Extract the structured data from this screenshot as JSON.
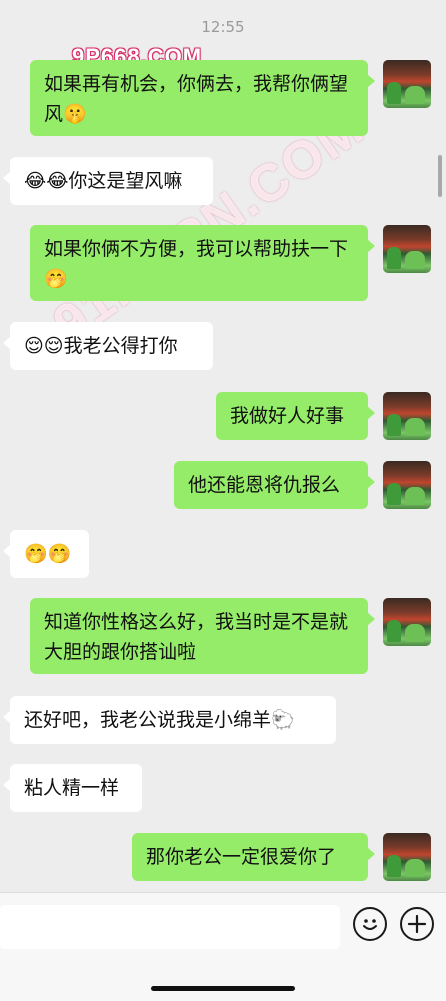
{
  "status": {
    "time": "12:55"
  },
  "watermarks": {
    "top": "9P668.COM",
    "diagonal": "91PORN.COM"
  },
  "messages": [
    {
      "side": "out",
      "text": "如果再有机会，你俩去，我帮你俩望风",
      "emoji": "🤫"
    },
    {
      "side": "in",
      "emoji_prefix": "😂😂",
      "text": "你这是望风嘛"
    },
    {
      "side": "out",
      "text": "如果你俩不方便，我可以帮助扶一下",
      "emoji": "🤭"
    },
    {
      "side": "in",
      "emoji_prefix": "😌😌",
      "text": "我老公得打你"
    },
    {
      "side": "out",
      "text": "我做好人好事"
    },
    {
      "side": "out",
      "text": "他还能恩将仇报么"
    },
    {
      "side": "in",
      "emoji_prefix": "🤭🤭",
      "text": ""
    },
    {
      "side": "out",
      "text": "知道你性格这么好，我当时是不是就大胆的跟你搭讪啦"
    },
    {
      "side": "in",
      "text": "还好吧，我老公说我是小绵羊",
      "emoji": "🐑"
    },
    {
      "side": "in",
      "text": "粘人精一样"
    },
    {
      "side": "out",
      "text": "那你老公一定很爱你了"
    }
  ],
  "input_bar": {
    "emoji_icon": "smiley-face-icon",
    "plus_icon": "plus-circle-icon"
  }
}
